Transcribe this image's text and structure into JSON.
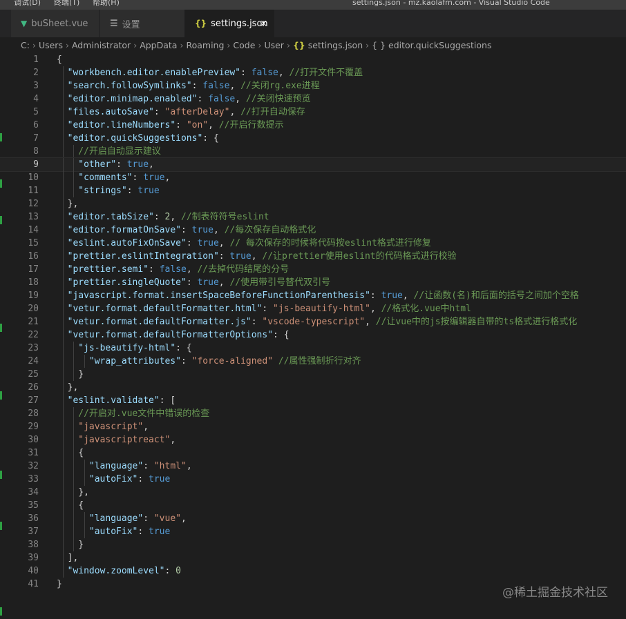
{
  "menubar": {
    "items": [
      "调试(D)",
      "终端(T)",
      "帮助(H)"
    ],
    "window_title": "settings.json - mz.kaolafm.com - Visual Studio Code"
  },
  "tabs": [
    {
      "label": "buSheet.vue",
      "icon": "vue-icon",
      "active": false
    },
    {
      "label": "设置",
      "icon": "gear-icon",
      "active": false
    },
    {
      "label": "settings.json",
      "icon": "json-icon",
      "active": true,
      "close_glyph": "×"
    }
  ],
  "breadcrumb": {
    "items": [
      "C:",
      "Users",
      "Administrator",
      "AppData",
      "Roaming",
      "Code",
      "User",
      "settings.json",
      "editor.quickSuggestions"
    ],
    "separator": "›",
    "file_icon_glyph": "{}",
    "object_icon_glyph": "{ }"
  },
  "editor": {
    "current_line": 9,
    "lines": [
      {
        "n": "1",
        "i": 0,
        "t": [
          [
            "p",
            "{"
          ]
        ]
      },
      {
        "n": "2",
        "i": 1,
        "t": [
          [
            "k",
            "\"workbench.editor.enablePreview\""
          ],
          [
            "p",
            ": "
          ],
          [
            "b",
            "false"
          ],
          [
            "p",
            ", "
          ],
          [
            "c",
            "//打开文件不覆盖"
          ]
        ]
      },
      {
        "n": "3",
        "i": 1,
        "t": [
          [
            "k",
            "\"search.followSymlinks\""
          ],
          [
            "p",
            ": "
          ],
          [
            "b",
            "false"
          ],
          [
            "p",
            ", "
          ],
          [
            "c",
            "//关闭rg.exe进程"
          ]
        ]
      },
      {
        "n": "4",
        "i": 1,
        "t": [
          [
            "k",
            "\"editor.minimap.enabled\""
          ],
          [
            "p",
            ": "
          ],
          [
            "b",
            "false"
          ],
          [
            "p",
            ", "
          ],
          [
            "c",
            "//关闭快速预览"
          ]
        ]
      },
      {
        "n": "5",
        "i": 1,
        "t": [
          [
            "k",
            "\"files.autoSave\""
          ],
          [
            "p",
            ": "
          ],
          [
            "s",
            "\"afterDelay\""
          ],
          [
            "p",
            ", "
          ],
          [
            "c",
            "//打开自动保存"
          ]
        ]
      },
      {
        "n": "6",
        "i": 1,
        "t": [
          [
            "k",
            "\"editor.lineNumbers\""
          ],
          [
            "p",
            ": "
          ],
          [
            "s",
            "\"on\""
          ],
          [
            "p",
            ", "
          ],
          [
            "c",
            "//开启行数提示"
          ]
        ]
      },
      {
        "n": "7",
        "i": 1,
        "t": [
          [
            "k",
            "\"editor.quickSuggestions\""
          ],
          [
            "p",
            ": {"
          ]
        ]
      },
      {
        "n": "8",
        "i": 2,
        "t": [
          [
            "c",
            "//开启自动显示建议"
          ]
        ]
      },
      {
        "n": "9",
        "i": 2,
        "t": [
          [
            "k",
            "\"other\""
          ],
          [
            "p",
            ": "
          ],
          [
            "b",
            "true"
          ],
          [
            "p",
            ","
          ]
        ]
      },
      {
        "n": "10",
        "i": 2,
        "t": [
          [
            "k",
            "\"comments\""
          ],
          [
            "p",
            ": "
          ],
          [
            "b",
            "true"
          ],
          [
            "p",
            ","
          ]
        ]
      },
      {
        "n": "11",
        "i": 2,
        "t": [
          [
            "k",
            "\"strings\""
          ],
          [
            "p",
            ": "
          ],
          [
            "b",
            "true"
          ]
        ]
      },
      {
        "n": "12",
        "i": 1,
        "t": [
          [
            "p",
            "},"
          ]
        ]
      },
      {
        "n": "13",
        "i": 1,
        "t": [
          [
            "k",
            "\"editor.tabSize\""
          ],
          [
            "p",
            ": "
          ],
          [
            "n",
            "2"
          ],
          [
            "p",
            ", "
          ],
          [
            "c",
            "//制表符符号eslint"
          ]
        ]
      },
      {
        "n": "14",
        "i": 1,
        "t": [
          [
            "k",
            "\"editor.formatOnSave\""
          ],
          [
            "p",
            ": "
          ],
          [
            "b",
            "true"
          ],
          [
            "p",
            ", "
          ],
          [
            "c",
            "//每次保存自动格式化"
          ]
        ]
      },
      {
        "n": "15",
        "i": 1,
        "t": [
          [
            "k",
            "\"eslint.autoFixOnSave\""
          ],
          [
            "p",
            ": "
          ],
          [
            "b",
            "true"
          ],
          [
            "p",
            ", "
          ],
          [
            "c",
            "// 每次保存的时候将代码按eslint格式进行修复"
          ]
        ]
      },
      {
        "n": "16",
        "i": 1,
        "t": [
          [
            "k",
            "\"prettier.eslintIntegration\""
          ],
          [
            "p",
            ": "
          ],
          [
            "b",
            "true"
          ],
          [
            "p",
            ", "
          ],
          [
            "c",
            "//让prettier使用eslint的代码格式进行校验"
          ]
        ]
      },
      {
        "n": "17",
        "i": 1,
        "t": [
          [
            "k",
            "\"prettier.semi\""
          ],
          [
            "p",
            ": "
          ],
          [
            "b",
            "false"
          ],
          [
            "p",
            ", "
          ],
          [
            "c",
            "//去掉代码结尾的分号"
          ]
        ]
      },
      {
        "n": "18",
        "i": 1,
        "t": [
          [
            "k",
            "\"prettier.singleQuote\""
          ],
          [
            "p",
            ": "
          ],
          [
            "b",
            "true"
          ],
          [
            "p",
            ", "
          ],
          [
            "c",
            "//使用带引号替代双引号"
          ]
        ]
      },
      {
        "n": "19",
        "i": 1,
        "t": [
          [
            "k",
            "\"javascript.format.insertSpaceBeforeFunctionParenthesis\""
          ],
          [
            "p",
            ": "
          ],
          [
            "b",
            "true"
          ],
          [
            "p",
            ", "
          ],
          [
            "c",
            "//让函数(名)和后面的括号之间加个空格"
          ]
        ]
      },
      {
        "n": "20",
        "i": 1,
        "t": [
          [
            "k",
            "\"vetur.format.defaultFormatter.html\""
          ],
          [
            "p",
            ": "
          ],
          [
            "s",
            "\"js-beautify-html\""
          ],
          [
            "p",
            ", "
          ],
          [
            "c",
            "//格式化.vue中html"
          ]
        ]
      },
      {
        "n": "21",
        "i": 1,
        "t": [
          [
            "k",
            "\"vetur.format.defaultFormatter.js\""
          ],
          [
            "p",
            ": "
          ],
          [
            "s",
            "\"vscode-typescript\""
          ],
          [
            "p",
            ", "
          ],
          [
            "c",
            "//让vue中的js按编辑器自带的ts格式进行格式化"
          ]
        ]
      },
      {
        "n": "22",
        "i": 1,
        "t": [
          [
            "k",
            "\"vetur.format.defaultFormatterOptions\""
          ],
          [
            "p",
            ": {"
          ]
        ]
      },
      {
        "n": "23",
        "i": 2,
        "t": [
          [
            "k",
            "\"js-beautify-html\""
          ],
          [
            "p",
            ": {"
          ]
        ]
      },
      {
        "n": "24",
        "i": 3,
        "t": [
          [
            "k",
            "\"wrap_attributes\""
          ],
          [
            "p",
            ": "
          ],
          [
            "s",
            "\"force-aligned\""
          ],
          [
            "p",
            " "
          ],
          [
            "c",
            "//属性强制折行对齐"
          ]
        ]
      },
      {
        "n": "25",
        "i": 2,
        "t": [
          [
            "p",
            "}"
          ]
        ]
      },
      {
        "n": "26",
        "i": 1,
        "t": [
          [
            "p",
            "},"
          ]
        ]
      },
      {
        "n": "27",
        "i": 1,
        "t": [
          [
            "k",
            "\"eslint.validate\""
          ],
          [
            "p",
            ": ["
          ]
        ]
      },
      {
        "n": "28",
        "i": 2,
        "t": [
          [
            "c",
            "//开启对.vue文件中错误的检查"
          ]
        ]
      },
      {
        "n": "29",
        "i": 2,
        "t": [
          [
            "s",
            "\"javascript\""
          ],
          [
            "p",
            ","
          ]
        ]
      },
      {
        "n": "30",
        "i": 2,
        "t": [
          [
            "s",
            "\"javascriptreact\""
          ],
          [
            "p",
            ","
          ]
        ]
      },
      {
        "n": "31",
        "i": 2,
        "t": [
          [
            "p",
            "{"
          ]
        ]
      },
      {
        "n": "32",
        "i": 3,
        "t": [
          [
            "k",
            "\"language\""
          ],
          [
            "p",
            ": "
          ],
          [
            "s",
            "\"html\""
          ],
          [
            "p",
            ","
          ]
        ]
      },
      {
        "n": "33",
        "i": 3,
        "t": [
          [
            "k",
            "\"autoFix\""
          ],
          [
            "p",
            ": "
          ],
          [
            "b",
            "true"
          ]
        ]
      },
      {
        "n": "34",
        "i": 2,
        "t": [
          [
            "p",
            "},"
          ]
        ]
      },
      {
        "n": "35",
        "i": 2,
        "t": [
          [
            "p",
            "{"
          ]
        ]
      },
      {
        "n": "36",
        "i": 3,
        "t": [
          [
            "k",
            "\"language\""
          ],
          [
            "p",
            ": "
          ],
          [
            "s",
            "\"vue\""
          ],
          [
            "p",
            ","
          ]
        ]
      },
      {
        "n": "37",
        "i": 3,
        "t": [
          [
            "k",
            "\"autoFix\""
          ],
          [
            "p",
            ": "
          ],
          [
            "b",
            "true"
          ]
        ]
      },
      {
        "n": "38",
        "i": 2,
        "t": [
          [
            "p",
            "}"
          ]
        ]
      },
      {
        "n": "39",
        "i": 1,
        "t": [
          [
            "p",
            "],"
          ]
        ]
      },
      {
        "n": "40",
        "i": 1,
        "t": [
          [
            "k",
            "\"window.zoomLevel\""
          ],
          [
            "p",
            ": "
          ],
          [
            "n",
            "0"
          ]
        ]
      },
      {
        "n": "41",
        "i": 0,
        "t": [
          [
            "p",
            "}"
          ]
        ]
      }
    ]
  },
  "watermark": "@稀土掘金技术社区",
  "colors": {
    "editor_bg": "#1e1e1e",
    "key": "#9cdcfe",
    "string": "#ce9178",
    "boolean": "#569cd6",
    "number": "#b5cea8",
    "comment": "#6a9955",
    "vue_green": "#41b883",
    "json_yellow": "#cbcb41",
    "git_added": "#2ea043"
  }
}
